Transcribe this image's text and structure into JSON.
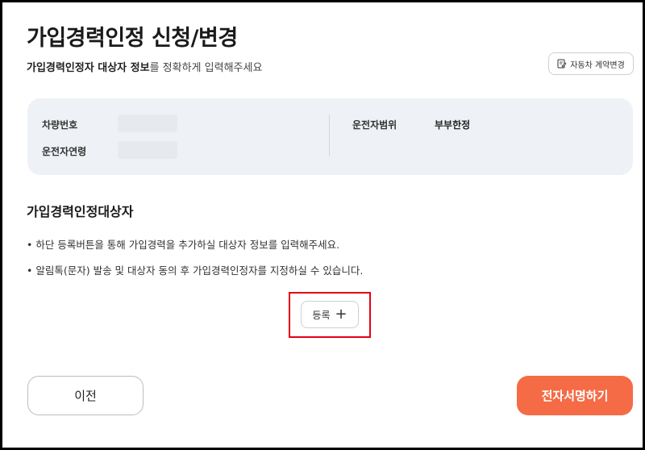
{
  "header": {
    "title": "가입경력인정 신청/변경",
    "subtitle_bold": "가입경력인정자 대상자 정보",
    "subtitle_rest": "를 정확하게 입력해주세요",
    "contract_change_label": "자동차 계약변경"
  },
  "info": {
    "car_number_label": "차량번호",
    "driver_age_label": "운전자연령",
    "driver_scope_label": "운전자범위",
    "driver_scope_value": "부부한정"
  },
  "section": {
    "title": "가입경력인정대상자",
    "bullets": [
      "• 하단 등록버튼을 통해 가입경력을 추가하실 대상자 정보를 입력해주세요.",
      "• 알림톡(문자) 발송 및 대상자 동의 후 가입경력인정자를 지정하실 수 있습니다."
    ],
    "register_label": "등록",
    "register_icon": "plus-icon"
  },
  "footer": {
    "prev_label": "이전",
    "sign_label": "전자서명하기"
  },
  "colors": {
    "accent": "#f56b45",
    "highlight": "#e60012",
    "card_bg": "#eef1f5"
  }
}
